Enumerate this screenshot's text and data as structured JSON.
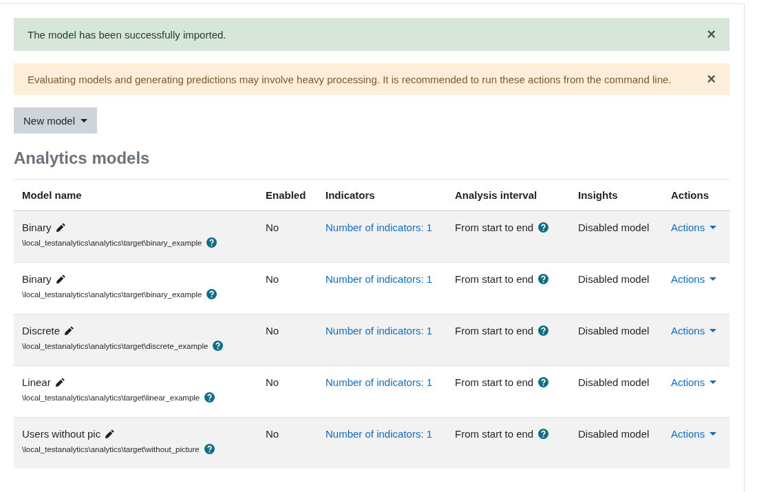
{
  "alerts": [
    {
      "kind": "success",
      "message": "The model has been successfully imported.",
      "close": "×"
    },
    {
      "kind": "warning",
      "message": "Evaluating models and generating predictions may involve heavy processing. It is recommended to run these actions from the command line.",
      "close": "×"
    }
  ],
  "new_model_button": {
    "label": "New model"
  },
  "heading": "Analytics models",
  "table": {
    "columns": [
      "Model name",
      "Enabled",
      "Indicators",
      "Analysis interval",
      "Insights",
      "Actions"
    ],
    "rows": [
      {
        "name": "Binary",
        "target": "\\local_testanalytics\\analytics\\target\\binary_example",
        "enabled": "No",
        "indicators": "Number of indicators: 1",
        "interval": "From start to end",
        "insights": "Disabled model",
        "actions": "Actions"
      },
      {
        "name": "Binary",
        "target": "\\local_testanalytics\\analytics\\target\\binary_example",
        "enabled": "No",
        "indicators": "Number of indicators: 1",
        "interval": "From start to end",
        "insights": "Disabled model",
        "actions": "Actions"
      },
      {
        "name": "Discrete",
        "target": "\\local_testanalytics\\analytics\\target\\discrete_example",
        "enabled": "No",
        "indicators": "Number of indicators: 1",
        "interval": "From start to end",
        "insights": "Disabled model",
        "actions": "Actions"
      },
      {
        "name": "Linear",
        "target": "\\local_testanalytics\\analytics\\target\\linear_example",
        "enabled": "No",
        "indicators": "Number of indicators: 1",
        "interval": "From start to end",
        "insights": "Disabled model",
        "actions": "Actions"
      },
      {
        "name": "Users without pic",
        "target": "\\local_testanalytics\\analytics\\target\\without_picture",
        "enabled": "No",
        "indicators": "Number of indicators: 1",
        "interval": "From start to end",
        "insights": "Disabled model",
        "actions": "Actions"
      }
    ]
  }
}
